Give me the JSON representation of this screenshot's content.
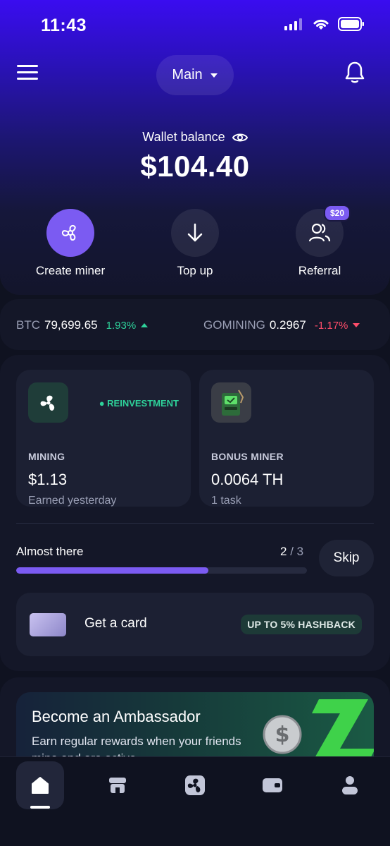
{
  "status": {
    "time": "11:43"
  },
  "header": {
    "account": "Main"
  },
  "wallet": {
    "label": "Wallet balance",
    "amount": "$104.40"
  },
  "actions": [
    {
      "label": "Create miner",
      "icon": "fan-icon"
    },
    {
      "label": "Top up",
      "icon": "arrow-down-icon"
    },
    {
      "label": "Referral",
      "icon": "users-icon",
      "badge": "$20"
    }
  ],
  "ticker": {
    "btc": {
      "symbol": "BTC",
      "price": "79,699.65",
      "change": "1.93%",
      "direction": "up"
    },
    "gomining": {
      "symbol": "GOMINING",
      "price": "0.2967",
      "change": "-1.17%",
      "direction": "down"
    }
  },
  "cards": {
    "mining": {
      "badge": "REINVESTMENT",
      "title": "MINING",
      "value": "$1.13",
      "sub": "Earned yesterday"
    },
    "bonus": {
      "title": "BONUS MINER",
      "value": "0.0064 TH",
      "sub": "1 task"
    }
  },
  "progress": {
    "label": "Almost there",
    "current": "2",
    "separator": " / ",
    "total": "3",
    "fraction": 0.66,
    "skip": "Skip"
  },
  "card_offer": {
    "text": "Get a card",
    "pill": "UP TO 5% HASHBACK"
  },
  "promo": {
    "title": "Become an Ambassador",
    "desc": "Earn regular rewards when your friends mine and are active"
  },
  "nav": [
    {
      "icon": "home-icon",
      "active": true
    },
    {
      "icon": "store-icon"
    },
    {
      "icon": "fan-icon"
    },
    {
      "icon": "wallet-icon"
    },
    {
      "icon": "profile-icon"
    }
  ],
  "colors": {
    "accent": "#7b5bf2",
    "positive": "#2ed29a",
    "negative": "#ff4d6a"
  }
}
